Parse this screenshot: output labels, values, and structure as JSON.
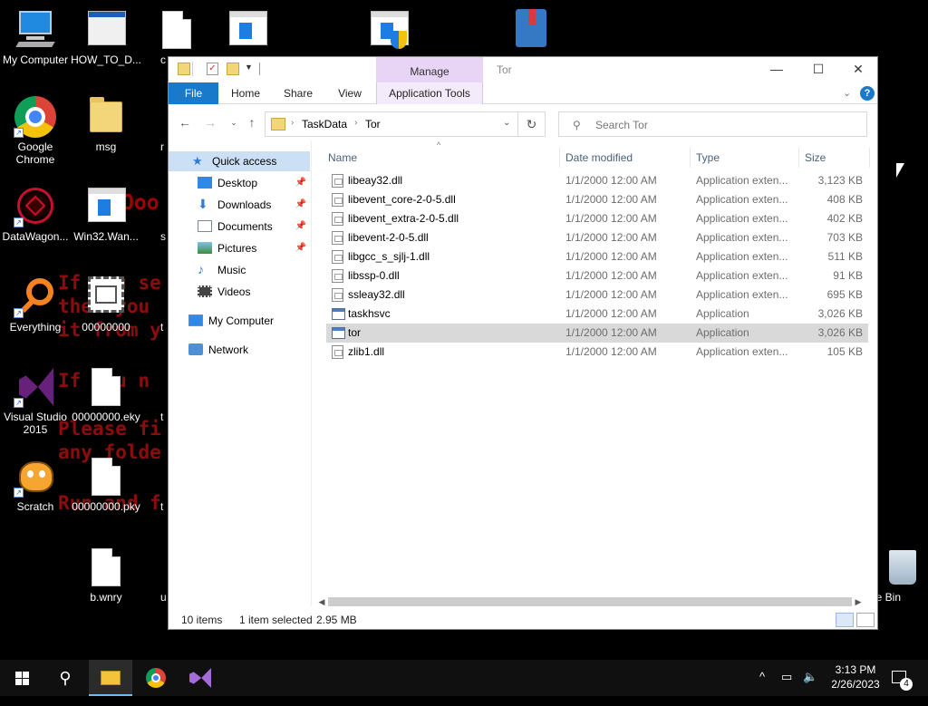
{
  "desktop": {
    "wallpaper_lines": [
      "Ooo",
      "If you se",
      "then you",
      "it from y",
      "If you n",
      "Please fi",
      "any folde",
      "Run and f"
    ],
    "icons": [
      {
        "label": "My Computer",
        "icon": "computer-icon"
      },
      {
        "label": "HOW_TO_D...",
        "icon": "window-icon"
      },
      {
        "label": "c",
        "icon": "document-icon"
      },
      {
        "label": "Google Chrome",
        "icon": "chrome-icon"
      },
      {
        "label": "msg",
        "icon": "folder-icon"
      },
      {
        "label": "r",
        "icon": "document-icon"
      },
      {
        "label": "DataWagon...",
        "icon": "datawagon-icon"
      },
      {
        "label": "Win32.Wan...",
        "icon": "window-icon"
      },
      {
        "label": "s",
        "icon": "document-icon"
      },
      {
        "label": "Everything",
        "icon": "everything-icon"
      },
      {
        "label": "00000000",
        "icon": "image-icon"
      },
      {
        "label": "t",
        "icon": "document-icon"
      },
      {
        "label": "Visual Studio 2015",
        "icon": "visual-studio-icon"
      },
      {
        "label": "00000000.eky",
        "icon": "document-icon"
      },
      {
        "label": "t",
        "icon": "document-icon"
      },
      {
        "label": "Scratch",
        "icon": "scratch-icon"
      },
      {
        "label": "00000000.pky",
        "icon": "document-icon"
      },
      {
        "label": "t",
        "icon": "document-icon"
      },
      {
        "label": "b.wnry",
        "icon": "document-icon"
      },
      {
        "label": "u",
        "icon": "document-icon"
      },
      {
        "label": "cle Bin",
        "icon": "recycle-bin-icon"
      }
    ]
  },
  "window": {
    "title": "Tor",
    "manage_tab": "Manage",
    "ribbon_tabs": [
      "File",
      "Home",
      "Share",
      "View",
      "Application Tools"
    ],
    "controls": {
      "minimize": "—",
      "maximize": "☐",
      "close": "✕"
    },
    "help": "?"
  },
  "address": {
    "path": [
      "TaskData",
      "Tor"
    ],
    "search_placeholder": "Search Tor"
  },
  "navpane": {
    "items": [
      {
        "label": "Quick access",
        "icon": "star-icon",
        "pinned": false
      },
      {
        "label": "Desktop",
        "icon": "desktop-icon",
        "pinned": true
      },
      {
        "label": "Downloads",
        "icon": "download-icon",
        "pinned": true
      },
      {
        "label": "Documents",
        "icon": "documents-icon",
        "pinned": true
      },
      {
        "label": "Pictures",
        "icon": "pictures-icon",
        "pinned": true
      },
      {
        "label": "Music",
        "icon": "music-icon",
        "pinned": false
      },
      {
        "label": "Videos",
        "icon": "videos-icon",
        "pinned": false
      },
      {
        "label": "My Computer",
        "icon": "computer-icon",
        "pinned": false
      },
      {
        "label": "Network",
        "icon": "network-icon",
        "pinned": false
      }
    ]
  },
  "files": {
    "columns": [
      "Name",
      "Date modified",
      "Type",
      "Size"
    ],
    "rows": [
      {
        "name": "libeay32.dll",
        "date": "1/1/2000 12:00 AM",
        "type": "Application exten...",
        "size": "3,123 KB",
        "kind": "dll"
      },
      {
        "name": "libevent_core-2-0-5.dll",
        "date": "1/1/2000 12:00 AM",
        "type": "Application exten...",
        "size": "408 KB",
        "kind": "dll"
      },
      {
        "name": "libevent_extra-2-0-5.dll",
        "date": "1/1/2000 12:00 AM",
        "type": "Application exten...",
        "size": "402 KB",
        "kind": "dll"
      },
      {
        "name": "libevent-2-0-5.dll",
        "date": "1/1/2000 12:00 AM",
        "type": "Application exten...",
        "size": "703 KB",
        "kind": "dll"
      },
      {
        "name": "libgcc_s_sjlj-1.dll",
        "date": "1/1/2000 12:00 AM",
        "type": "Application exten...",
        "size": "511 KB",
        "kind": "dll"
      },
      {
        "name": "libssp-0.dll",
        "date": "1/1/2000 12:00 AM",
        "type": "Application exten...",
        "size": "91 KB",
        "kind": "dll"
      },
      {
        "name": "ssleay32.dll",
        "date": "1/1/2000 12:00 AM",
        "type": "Application exten...",
        "size": "695 KB",
        "kind": "dll"
      },
      {
        "name": "taskhsvc",
        "date": "1/1/2000 12:00 AM",
        "type": "Application",
        "size": "3,026 KB",
        "kind": "app"
      },
      {
        "name": "tor",
        "date": "1/1/2000 12:00 AM",
        "type": "Application",
        "size": "3,026 KB",
        "kind": "app",
        "selected": true
      },
      {
        "name": "zlib1.dll",
        "date": "1/1/2000 12:00 AM",
        "type": "Application exten...",
        "size": "105 KB",
        "kind": "dll"
      }
    ]
  },
  "status": {
    "count": "10 items",
    "selection": "1 item selected",
    "size": "2.95 MB"
  },
  "taskbar": {
    "time": "3:13 PM",
    "date": "2/26/2023",
    "notifications": "4",
    "apps": [
      "start-icon",
      "search-icon",
      "file-explorer-icon",
      "chrome-icon",
      "visual-studio-icon"
    ]
  },
  "colors": {
    "accent": "#1979ca",
    "manage": "#e8d4f5",
    "selection": "#cce0f5",
    "wallpaper_text": "#8b0d0d"
  }
}
